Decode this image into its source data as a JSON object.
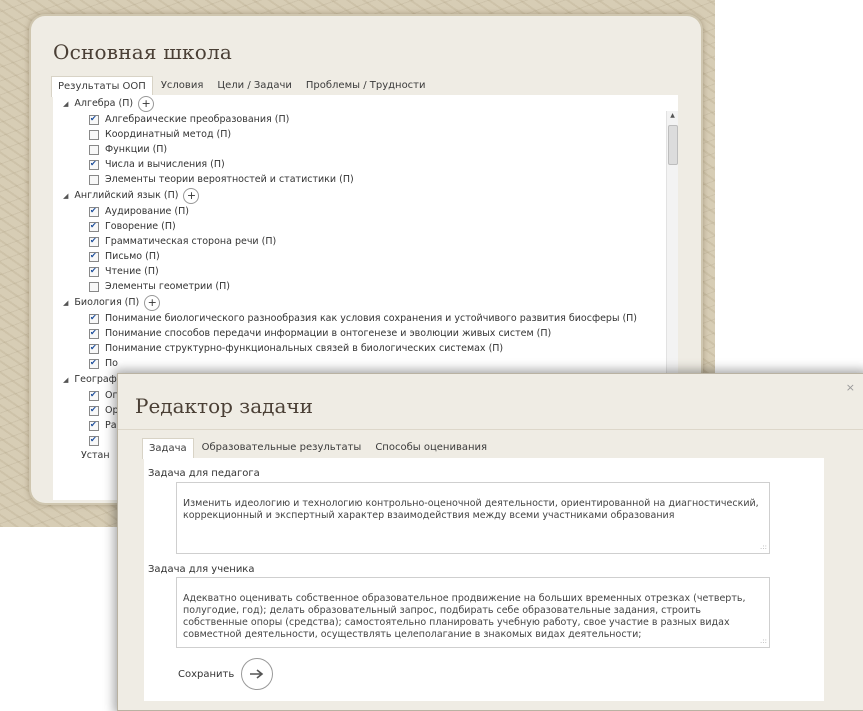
{
  "school": {
    "title": "Основная школа",
    "tabs": [
      {
        "label": "Результаты ООП"
      },
      {
        "label": "Условия"
      },
      {
        "label": "Цели / Задачи"
      },
      {
        "label": "Проблемы / Трудности"
      }
    ],
    "subjects": [
      {
        "name": "Алгебра (П)",
        "items": [
          {
            "label": "Алгебраические преобразования (П)",
            "checked": true
          },
          {
            "label": "Координатный метод (П)",
            "checked": false
          },
          {
            "label": "Функции (П)",
            "checked": false
          },
          {
            "label": "Числа и вычисления (П)",
            "checked": true
          },
          {
            "label": "Элементы теории вероятностей и статистики (П)",
            "checked": false
          }
        ]
      },
      {
        "name": "Английский язык (П)",
        "items": [
          {
            "label": "Аудирование (П)",
            "checked": true
          },
          {
            "label": "Говорение (П)",
            "checked": true
          },
          {
            "label": "Грамматическая сторона речи (П)",
            "checked": true
          },
          {
            "label": "Письмо (П)",
            "checked": true
          },
          {
            "label": "Чтение (П)",
            "checked": true
          },
          {
            "label": "Элементы геометрии (П)",
            "checked": false
          }
        ]
      },
      {
        "name": "Биология (П)",
        "items": [
          {
            "label": "Понимание биологического разнообразия как условия сохранения и устойчивого развития биосферы (П)",
            "checked": true
          },
          {
            "label": "Понимание способов передачи информации в онтогенезе и эволюции живых систем (П)",
            "checked": true
          },
          {
            "label": "Понимание структурно-функциональных связей в биологических системах (П)",
            "checked": true
          },
          {
            "label": "По",
            "checked": true
          }
        ]
      },
      {
        "name": "Географ",
        "items": [
          {
            "label": "Оп",
            "checked": true
          },
          {
            "label": "Ор",
            "checked": true
          },
          {
            "label": "Ра",
            "checked": true
          },
          {
            "label": "",
            "checked": true
          }
        ]
      }
    ],
    "tail": "Устан"
  },
  "modal": {
    "title": "Редактор задачи",
    "close": "×",
    "tabs": [
      {
        "label": "Задача"
      },
      {
        "label": "Образовательные результаты"
      },
      {
        "label": "Способы оценивания"
      }
    ],
    "teacher_label": "Задача для педагога",
    "teacher_text": "Изменить идеологию и технологию контрольно-оценочной деятельности, ориентированной на диагностический, коррекционный и экспертный характер взаимодействия между всеми участниками образования",
    "student_label": "Задача для ученика",
    "student_text": "Адекватно оценивать собственное образовательное продвижение на больших временных отрезках (четверть, полугодие, год); делать образовательный запрос, подбирать себе образовательные задания, строить собственные опоры (средства); самостоятельно планировать учебную работу, свое участие в разных видах совместной деятельности, осуществлять целеполагание в знакомых видах деятельности;",
    "save_label": "Сохранить"
  },
  "icons": {
    "plus": "plus-icon",
    "arrow": "arrow-right-icon",
    "expand": "triangle-expanded-icon",
    "grip": "resize-grip-icon"
  }
}
